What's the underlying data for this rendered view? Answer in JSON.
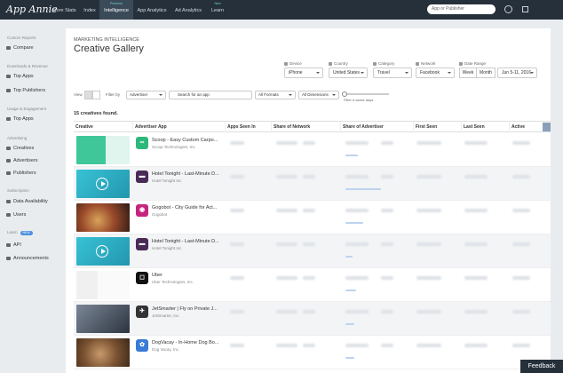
{
  "topnav": {
    "logo": "App Annie",
    "tabs": [
      {
        "label": "Store Stats"
      },
      {
        "label": "Index"
      },
      {
        "sup": "Premium",
        "label": "Intelligence",
        "active": true
      },
      {
        "label": "App Analytics"
      },
      {
        "label": "Ad Analytics"
      },
      {
        "sup": "New",
        "label": "Learn"
      }
    ],
    "search_placeholder": "App or Publisher"
  },
  "sidebar": {
    "sections": [
      {
        "heading": "Custom Reports",
        "items": [
          "Compare"
        ]
      },
      {
        "heading": "Downloads & Revenue",
        "items": [
          "Top Apps",
          "Top Publishers"
        ]
      },
      {
        "heading": "Usage & Engagement",
        "items": [
          "Top Apps"
        ]
      },
      {
        "heading": "Advertising",
        "items": [
          "Creatives",
          "Advertisers",
          "Publishers"
        ]
      },
      {
        "heading": "Subscription",
        "items": [
          "Data Availability",
          "Users"
        ]
      },
      {
        "heading": "Learn",
        "badge": "NEW",
        "items": [
          "API",
          "Announcements"
        ]
      }
    ]
  },
  "header": {
    "label": "MARKETING INTELLIGENCE",
    "title": "Creative Gallery"
  },
  "filters": {
    "device": {
      "label": "Device",
      "value": "iPhone"
    },
    "country": {
      "label": "Country",
      "value": "United States"
    },
    "category": {
      "label": "Category",
      "value": "Travel"
    },
    "network": {
      "label": "Network",
      "value": "Facebook"
    },
    "date_range": {
      "label": "Date Range",
      "week": "Week",
      "month": "Month",
      "value": "Jun 5-11, 2016"
    }
  },
  "toolbar": {
    "view_label": "View",
    "filter_by_label": "Filter by",
    "filter_by_value": "Advertiser",
    "search_placeholder": "Search for an app",
    "formats": "All Formats",
    "dimensions": "All Dimensions",
    "slider_label": "Filter # active days"
  },
  "results": {
    "count_text": "15 creatives found."
  },
  "table": {
    "columns": [
      "Creative",
      "Advertiser App",
      "Apps Seen In",
      "Share of Network",
      "Share of Advertiser",
      "First Seen",
      "Last Seen",
      "Active"
    ],
    "rows": [
      {
        "app": "Scoop - Easy Custom Carpo...",
        "publisher": "Scoop Technologies, Inc",
        "icon_color": "#2bb87a",
        "thumb": "scoop"
      },
      {
        "app": "Hotel Tonight - Last-Minute D...",
        "publisher": "Hotel Tonight Inc",
        "icon_color": "#4a2a56",
        "thumb": "video"
      },
      {
        "app": "Gogobot - City Guide for Act...",
        "publisher": "Gogobot",
        "icon_color": "#c6257e",
        "thumb": "food"
      },
      {
        "app": "Hotel Tonight - Last-Minute D...",
        "publisher": "Hotel Tonight Inc",
        "icon_color": "#4a2a56",
        "thumb": "video"
      },
      {
        "app": "Uber",
        "publisher": "Uber Technologies, Inc.",
        "icon_color": "#111111",
        "thumb": "uber"
      },
      {
        "app": "JetSmarter | Fly on Private J...",
        "publisher": "JetSmarter, Inc.",
        "icon_color": "#333333",
        "thumb": "phone"
      },
      {
        "app": "DogVacay - In-Home Dog Bo...",
        "publisher": "Dog Vacay, Inc.",
        "icon_color": "#3a7bd5",
        "thumb": "dog"
      }
    ]
  },
  "feedback": "Feedback"
}
